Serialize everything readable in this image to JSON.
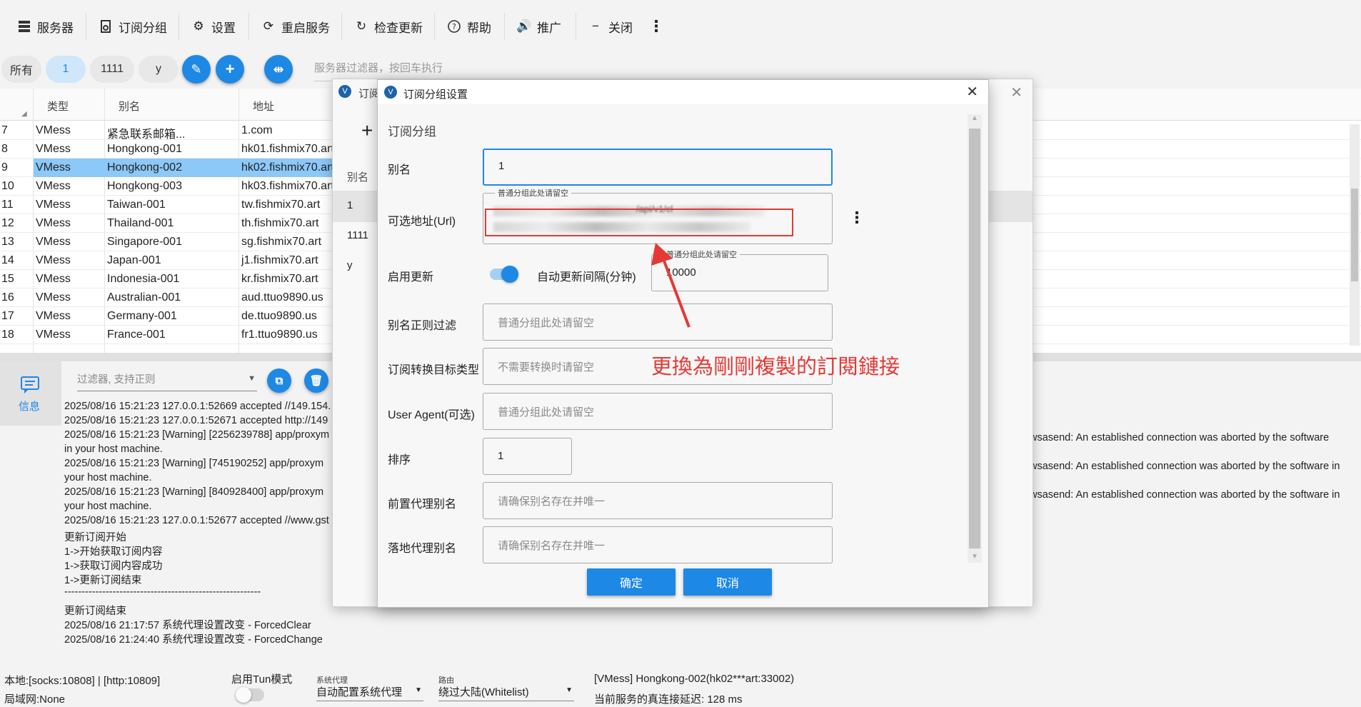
{
  "toolbar": {
    "servers": "服务器",
    "sub_group": "订阅分组",
    "settings": "设置",
    "restart": "重启服务",
    "check_update": "检查更新",
    "help": "帮助",
    "promote": "推广",
    "close": "关闭"
  },
  "chips": {
    "all": "所有",
    "c1": "1",
    "c2": "1111",
    "c3": "y"
  },
  "server_filter_placeholder": "服务器过滤器，按回车执行",
  "table": {
    "headers": [
      "类型",
      "别名",
      "地址"
    ],
    "rows": [
      {
        "n": "7",
        "type": "VMess",
        "alias": "紧急联系邮箱...",
        "addr": "1.com"
      },
      {
        "n": "8",
        "type": "VMess",
        "alias": "Hongkong-001",
        "addr": "hk01.fishmix70.art"
      },
      {
        "n": "9",
        "type": "VMess",
        "alias": "Hongkong-002",
        "addr": "hk02.fishmix70.art"
      },
      {
        "n": "10",
        "type": "VMess",
        "alias": "Hongkong-003",
        "addr": "hk03.fishmix70.art"
      },
      {
        "n": "11",
        "type": "VMess",
        "alias": "Taiwan-001",
        "addr": "tw.fishmix70.art"
      },
      {
        "n": "12",
        "type": "VMess",
        "alias": "Thailand-001",
        "addr": "th.fishmix70.art"
      },
      {
        "n": "13",
        "type": "VMess",
        "alias": "Singapore-001",
        "addr": "sg.fishmix70.art"
      },
      {
        "n": "14",
        "type": "VMess",
        "alias": "Japan-001",
        "addr": "j1.fishmix70.art"
      },
      {
        "n": "15",
        "type": "VMess",
        "alias": "Indonesia-001",
        "addr": "kr.fishmix70.art"
      },
      {
        "n": "16",
        "type": "VMess",
        "alias": "Australian-001",
        "addr": "aud.ttuo9890.us"
      },
      {
        "n": "17",
        "type": "VMess",
        "alias": "Germany-001",
        "addr": "de.ttuo9890.us"
      },
      {
        "n": "18",
        "type": "VMess",
        "alias": "France-001",
        "addr": "fr1.ttuo9890.us"
      }
    ]
  },
  "log": {
    "side_label": "信息",
    "filter_placeholder": "过滤器, 支持正则",
    "lines": [
      "2025/08/16 15:21:23 127.0.0.1:52669 accepted //149.154.",
      "2025/08/16 15:21:23 127.0.0.1:52671 accepted http://149",
      "2025/08/16 15:21:23 [Warning] [2256239788] app/proxym",
      "in your host machine.",
      "2025/08/16 15:21:23 [Warning] [745190252] app/proxym",
      "your host machine.",
      "2025/08/16 15:21:23 [Warning] [840928400] app/proxym",
      "your host machine.",
      "2025/08/16 15:21:23 127.0.0.1:52677 accepted //www.gst",
      "更新订阅开始",
      "1->开始获取订阅内容",
      "1->获取订阅内容成功",
      "1->更新订阅结束",
      "---------------------------------------------------------",
      "更新订阅结束",
      "2025/08/16 21:17:57 系统代理设置改变 - ForcedClear",
      "2025/08/16 21:24:40 系统代理设置改变 - ForcedChange"
    ],
    "right_lines": [
      "wsasend: An established connection was aborted by the software",
      "wsasend: An established connection was aborted by the software in",
      "wsasend: An established connection was aborted by the software in"
    ]
  },
  "status": {
    "local": "本地:[socks:10808] | [http:10809]",
    "lan": "局域网:None",
    "tun_label": "启用Tun模式",
    "sysproxy_label": "系统代理",
    "sysproxy_value": "自动配置系统代理",
    "route_label": "路由",
    "route_value": "绕过大陆(Whitelist)",
    "current_server": "[VMess] Hongkong-002(hk02***art:33002)",
    "latency": "当前服务的真连接延迟: 128 ms"
  },
  "back_window": {
    "title": "订阅",
    "col_alias": "别名",
    "rows": [
      "1",
      "1111",
      "y"
    ]
  },
  "dialog": {
    "title": "订阅分组设置",
    "section": "订阅分组",
    "alias_label": "别名",
    "alias_value": "1",
    "url_label": "可选地址(Url)",
    "url_legend": "普通分组此处请留空",
    "url_fragment": "/api/v1/cl",
    "enable_update_label": "启用更新",
    "interval_label": "自动更新间隔(分钟)",
    "interval_legend": "普通分组此处请留空",
    "interval_value": "10000",
    "alias_regex_label": "别名正则过滤",
    "alias_regex_ph": "普通分组此处请留空",
    "convert_label": "订阅转换目标类型",
    "convert_ph": "不需要转换时请留空",
    "ua_label": "User Agent(可选)",
    "ua_ph": "普通分组此处请留空",
    "sort_label": "排序",
    "sort_value": "1",
    "prev_proxy_label": "前置代理别名",
    "prev_proxy_ph": "请确保别名存在并唯一",
    "land_proxy_label": "落地代理别名",
    "land_proxy_ph": "请确保别名存在并唯一",
    "ok": "确定",
    "cancel": "取消"
  },
  "annotation": {
    "text": "更換為剛剛複製的訂閱鏈接",
    "color": "#e53935"
  },
  "colors": {
    "accent": "#1e88e5",
    "selection": "#8cc8f8"
  }
}
